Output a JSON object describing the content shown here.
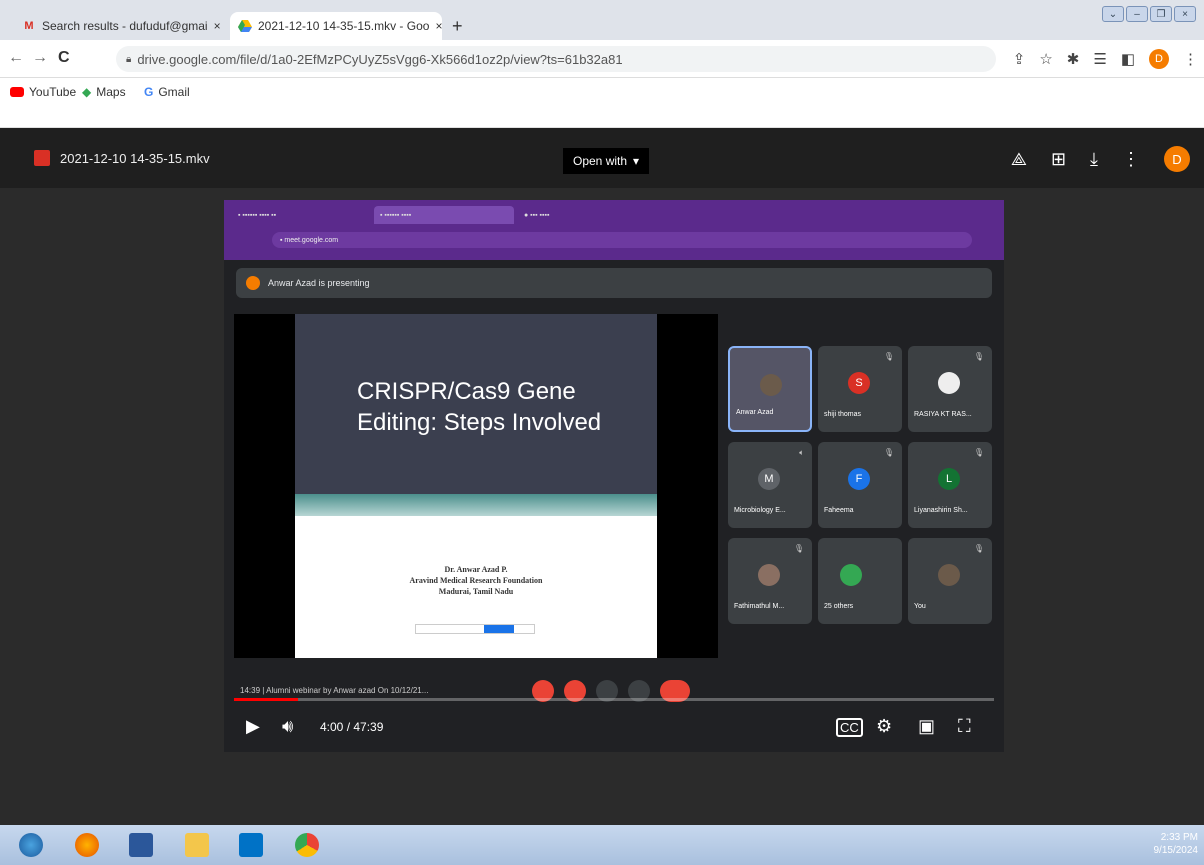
{
  "browser": {
    "tabs": [
      {
        "label": "Search results - dufuduf@gmai",
        "icon": "gmail-icon",
        "close": "×"
      },
      {
        "label": "2021-12-10 14-35-15.mkv - Goo",
        "icon": "drive-icon",
        "close": "×"
      }
    ],
    "new_tab": "+",
    "url": "drive.google.com/file/d/1a0-2EfMzPCyUyZ5sVgg6-Xk566d1oz2p/view?ts=61b32a81",
    "bookmarks": [
      "YouTube",
      "Maps",
      "Gmail"
    ],
    "profile_initial": "D"
  },
  "drive": {
    "filename": "2021-12-10 14-35-15.mkv",
    "open_with": "Open with",
    "avatar": "D"
  },
  "meet": {
    "presenting": "Anwar Azad is presenting",
    "slide": {
      "title_line1": "CRISPR/Cas9 Gene",
      "title_line2": "Editing: Steps Involved",
      "author": "Dr. Anwar Azad P.",
      "org": "Aravind Medical Research Foundation",
      "location": "Madurai, Tamil Nadu"
    },
    "tiles": [
      {
        "name": "Anwar Azad",
        "initial": "",
        "color": "#556"
      },
      {
        "name": "shiji thomas",
        "initial": "S",
        "color": "#d93025"
      },
      {
        "name": "RASIYA KT RAS...",
        "initial": "",
        "color": "#eee"
      },
      {
        "name": "Microbiology E...",
        "initial": "M",
        "color": "#5f6368"
      },
      {
        "name": "Faheema",
        "initial": "F",
        "color": "#1a73e8"
      },
      {
        "name": "Liyanashirin Sh...",
        "initial": "L",
        "color": "#137333"
      },
      {
        "name": "Fathimathul M...",
        "initial": "",
        "color": "#8a6f62"
      },
      {
        "name": "25 others",
        "initial": "",
        "color": "#3c4043"
      },
      {
        "name": "You",
        "initial": "",
        "color": "#6b5a4a"
      }
    ],
    "meeting_title": "14:39 | Alumni webinar by Anwar azad On 10/12/21..."
  },
  "player": {
    "time": "4:00 / 47:39",
    "progress": 0.084
  },
  "system": {
    "clock_time": "2:33 PM",
    "clock_date": "9/15/2024"
  }
}
